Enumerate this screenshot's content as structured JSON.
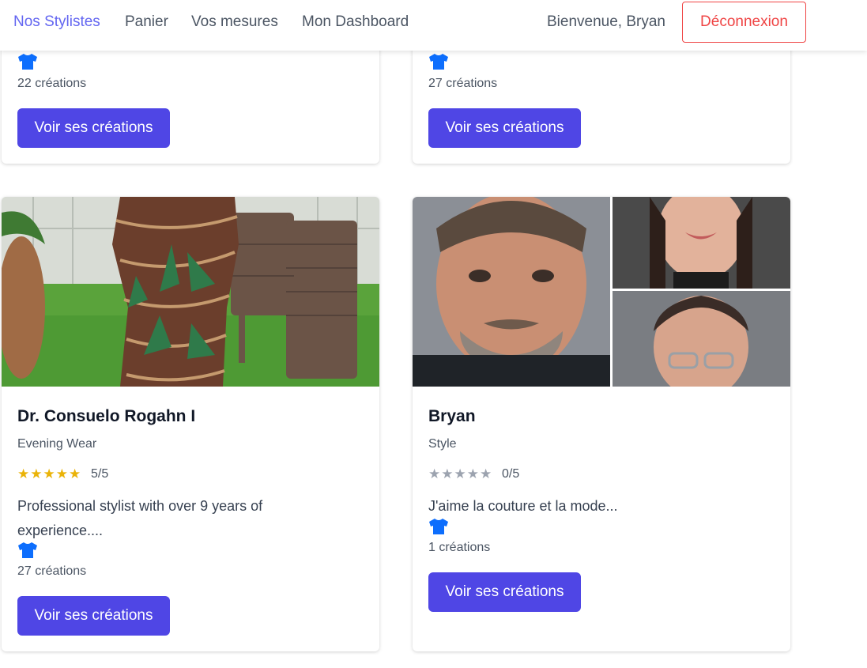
{
  "nav": {
    "links": [
      "Nos Stylistes",
      "Panier",
      "Vos mesures",
      "Mon Dashboard"
    ],
    "welcome": "Bienvenue, Bryan",
    "logout": "Déconnexion"
  },
  "colors": {
    "accent": "#6366f1",
    "button": "#4f46e5",
    "danger": "#ef4444",
    "shirt_icon": "#0d6efd",
    "star_filled": "#eab308",
    "star_empty": "#9ca3af"
  },
  "top_cards": [
    {
      "count": "22 créations",
      "button": "Voir ses créations"
    },
    {
      "count": "27 créations",
      "button": "Voir ses créations"
    }
  ],
  "cards": [
    {
      "name": "Dr. Consuelo Rogahn I",
      "specialty": "Evening Wear",
      "stars": "★★★★★",
      "rating": 5,
      "rating_label": "5/5",
      "description": "Professional stylist with over 9 years of experience....",
      "count": "27 créations",
      "button": "Voir ses créations"
    },
    {
      "name": "Bryan",
      "specialty": "Style",
      "stars": "★★★★★",
      "rating": 0,
      "rating_label": "0/5",
      "description": "J'aime la couture et la mode...",
      "count": "1 créations",
      "button": "Voir ses créations"
    }
  ]
}
